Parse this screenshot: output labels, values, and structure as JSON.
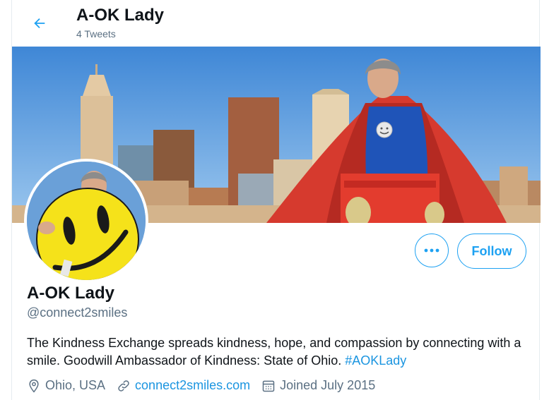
{
  "header": {
    "title": "A-OK Lady",
    "tweet_count": "4 Tweets"
  },
  "profile": {
    "name": "A-OK Lady",
    "handle": "@connect2smiles",
    "bio_text": "The Kindness Exchange spreads kindness, hope, and compassion by connecting with a smile. Goodwill Ambassador of Kindness: State of Ohio. ",
    "bio_hashtag": "#AOKLady",
    "location": "Ohio, USA",
    "website": "connect2smiles.com",
    "joined": "Joined July 2015"
  },
  "actions": {
    "more_label": "•••",
    "follow_label": "Follow"
  },
  "icons": {
    "back": "arrow-left-icon",
    "more": "more-icon",
    "location": "location-pin-icon",
    "link": "link-icon",
    "calendar": "calendar-icon"
  },
  "colors": {
    "accent": "#1da1f2",
    "link": "#1b95e0",
    "secondary_text": "#5b7083"
  }
}
